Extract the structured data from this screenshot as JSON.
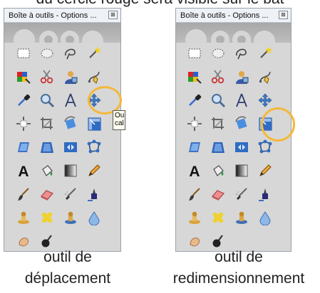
{
  "header_text": "du cercle rouge sera visible sur le bat",
  "window_title": "Boîte à outils - Options ...",
  "close_glyph": "⊠",
  "tooltip_lines": [
    "Ou",
    "cal"
  ],
  "captions": {
    "left_line1": "outil de",
    "left_line2": "déplacement",
    "right_line1": "outil de",
    "right_line2": "redimensionnement"
  },
  "highlight_color": "#f4b83a",
  "tools": [
    "rect-select-icon",
    "ellipse-select-icon",
    "free-select-icon",
    "fuzzy-select-icon",
    "color-select-icon",
    "scissors-icon",
    "foreground-select-icon",
    "paths-icon",
    "color-picker-icon",
    "zoom-icon",
    "measure-icon",
    "move-icon",
    "align-icon",
    "crop-icon",
    "rotate-icon",
    "scale-icon",
    "shear-icon",
    "perspective-icon",
    "flip-icon",
    "cage-icon",
    "text-icon",
    "bucket-fill-icon",
    "blend-icon",
    "pencil-icon",
    "paintbrush-icon",
    "eraser-icon",
    "airbrush-icon",
    "ink-icon",
    "clone-icon",
    "heal-icon",
    "perspective-clone-icon",
    "blur-icon",
    "smudge-icon",
    "dodge-burn-icon"
  ]
}
